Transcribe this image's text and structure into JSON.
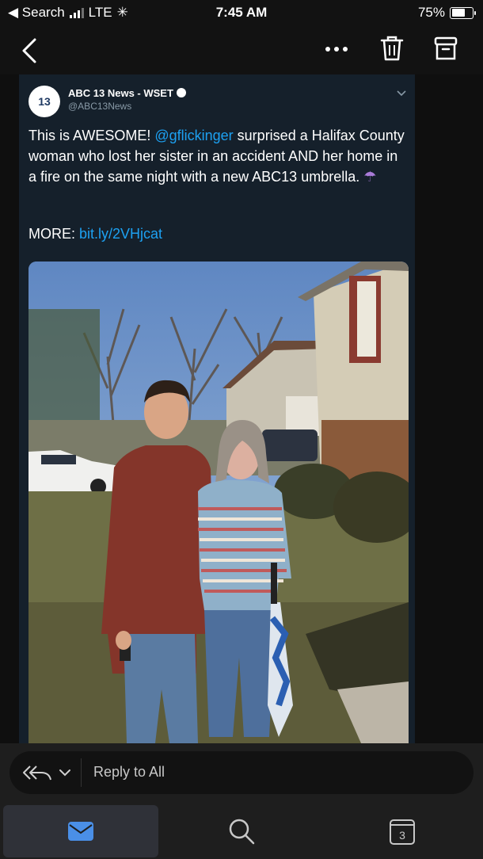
{
  "status_bar": {
    "back_app": "Search",
    "carrier": "LTE",
    "time": "7:45 AM",
    "battery": "75%",
    "battery_level": 0.75
  },
  "tweet": {
    "account_name": "ABC 13 News - WSET",
    "handle": "@ABC13News",
    "avatar_text": "13",
    "text_before": "This is AWESOME! ",
    "mention": "@gflickinger",
    "text_after": " surprised a Halifax County woman who lost her sister in an accident AND her home in a fire on the same night with a new ABC13 umbrella.",
    "emoji": "☂",
    "more_label": "MORE: ",
    "more_link": "bit.ly/2VHjcat"
  },
  "reply_bar": {
    "label": "Reply to All"
  },
  "tab_bar": {
    "calendar_day": "3"
  },
  "colors": {
    "link": "#1da1f2",
    "tweet_bg": "#15202b",
    "mail_accent": "#4a8fe7"
  }
}
